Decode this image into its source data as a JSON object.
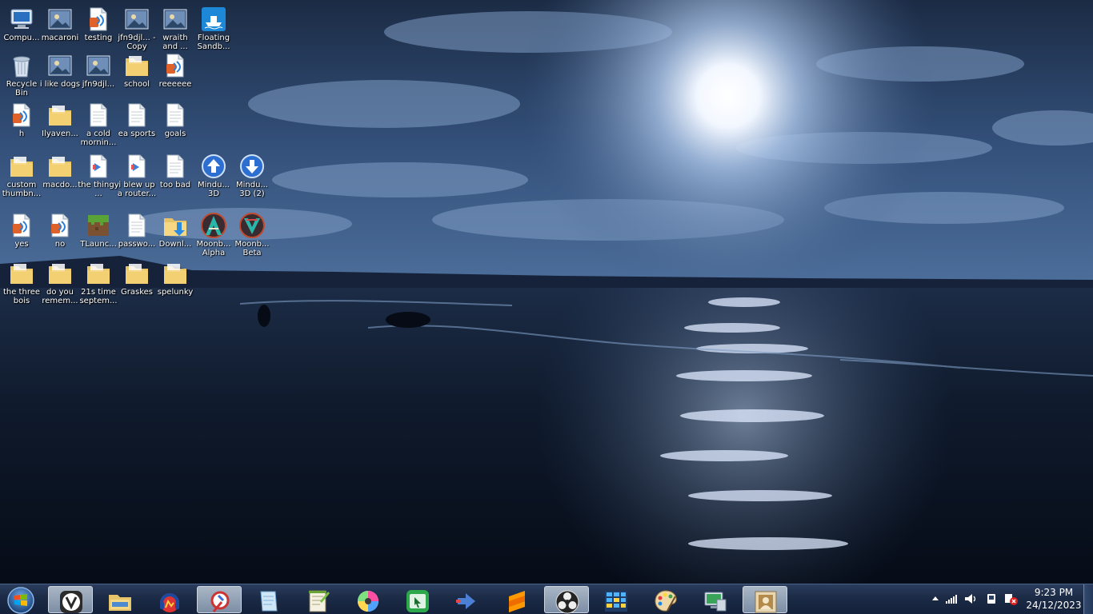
{
  "desktop": {
    "icons": [
      {
        "label": "Compu...",
        "icon": "computer-icon"
      },
      {
        "label": "macaroni",
        "icon": "image-icon"
      },
      {
        "label": "testing",
        "icon": "audio-file-icon"
      },
      {
        "label": "jfn9djl... - Copy",
        "icon": "image-icon"
      },
      {
        "label": "wraith and ...",
        "icon": "image-icon"
      },
      {
        "label": "Floating Sandb...",
        "icon": "game-icon"
      },
      {
        "label": "Recycle Bin",
        "icon": "recycle-bin-icon"
      },
      {
        "label": "i like dogs",
        "icon": "image-icon"
      },
      {
        "label": "jfn9djl...",
        "icon": "image-icon"
      },
      {
        "label": "school",
        "icon": "folder-icon"
      },
      {
        "label": "reeeeee",
        "icon": "audio-file-icon"
      },
      {
        "label": "h",
        "icon": "audio-file-icon"
      },
      {
        "label": "Ilyaven...",
        "icon": "folder-icon"
      },
      {
        "label": "a cold mornin...",
        "icon": "text-file-icon"
      },
      {
        "label": "ea sports",
        "icon": "text-file-icon"
      },
      {
        "label": "goals",
        "icon": "text-file-icon"
      },
      {
        "label": "custom thumbn...",
        "icon": "folder-icon"
      },
      {
        "label": "macdo...",
        "icon": "folder-icon"
      },
      {
        "label": "the thingy ...",
        "icon": "media-file-icon"
      },
      {
        "label": "i blew up a router...",
        "icon": "media-file-icon"
      },
      {
        "label": "too bad",
        "icon": "text-file-icon"
      },
      {
        "label": "Mindu... 3D",
        "icon": "upload-arrow-icon"
      },
      {
        "label": "Mindu... 3D (2)",
        "icon": "download-arrow-icon"
      },
      {
        "label": "yes",
        "icon": "audio-file-icon"
      },
      {
        "label": "no",
        "icon": "audio-file-icon"
      },
      {
        "label": "TLaunc...",
        "icon": "minecraft-block-icon"
      },
      {
        "label": "passwo...",
        "icon": "text-file-icon"
      },
      {
        "label": "Downl...",
        "icon": "downloads-folder-icon"
      },
      {
        "label": "Moonb... Alpha",
        "icon": "moonbase-alpha-icon"
      },
      {
        "label": "Moonb... Beta",
        "icon": "moonbase-beta-icon"
      },
      {
        "label": "the three bois",
        "icon": "folder-icon"
      },
      {
        "label": "do you remem...",
        "icon": "folder-icon"
      },
      {
        "label": "21s time septem...",
        "icon": "folder-icon"
      },
      {
        "label": "Graskes",
        "icon": "folder-icon"
      },
      {
        "label": "spelunky",
        "icon": "folder-icon"
      }
    ]
  },
  "taskbar": {
    "start_icon": "windows-start-orb-icon",
    "pinned": [
      {
        "icon": "vivaldi-icon",
        "active": true
      },
      {
        "icon": "file-explorer-icon",
        "active": false
      },
      {
        "icon": "audio-app-icon",
        "active": false
      },
      {
        "icon": "paint-tool-icon",
        "active": true
      },
      {
        "icon": "notes-icon",
        "active": false
      },
      {
        "icon": "notepad-plus-icon",
        "active": false
      },
      {
        "icon": "color-disc-icon",
        "active": false
      },
      {
        "icon": "cursor-app-icon",
        "active": false
      },
      {
        "icon": "media-arrow-icon",
        "active": false
      },
      {
        "icon": "sublime-text-icon",
        "active": false
      },
      {
        "icon": "obs-studio-icon",
        "active": true
      },
      {
        "icon": "spreadsheet-grid-icon",
        "active": false
      },
      {
        "icon": "paint-palette-icon",
        "active": false
      },
      {
        "icon": "remote-desktop-icon",
        "active": false
      },
      {
        "icon": "photo-viewer-icon",
        "active": true
      }
    ],
    "tray": {
      "icons": [
        "show-hidden-icons-icon",
        "network-signal-icon",
        "volume-icon",
        "device-icon",
        "action-center-icon"
      ]
    },
    "clock": {
      "time": "9:23 PM",
      "date": "24/12/2023"
    }
  }
}
